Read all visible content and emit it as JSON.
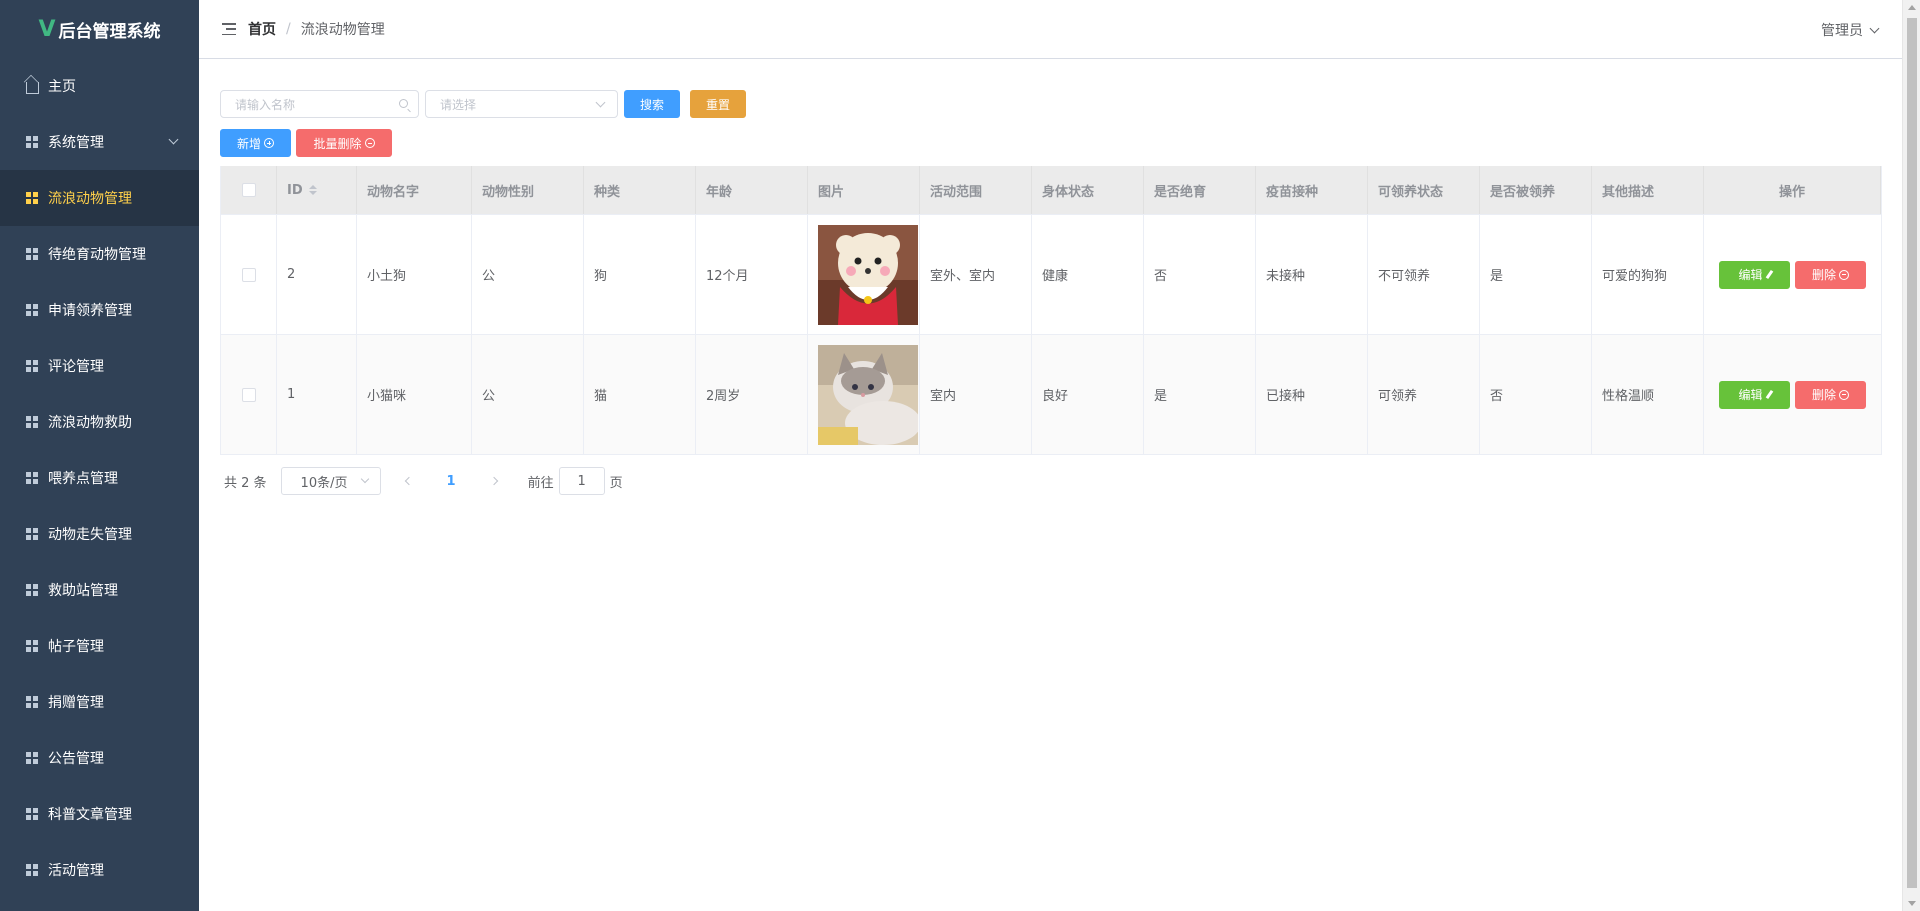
{
  "app": {
    "title": "后台管理系统",
    "logo_letter": "V",
    "accent": "#41b883"
  },
  "sidebar": {
    "bg": "#304156",
    "items": [
      {
        "label": "主页",
        "icon": "home-icon"
      },
      {
        "label": "系统管理",
        "icon": "grid-icon",
        "expandable": true
      },
      {
        "label": "流浪动物管理",
        "icon": "grid-icon",
        "active": true
      },
      {
        "label": "待绝育动物管理",
        "icon": "grid-icon"
      },
      {
        "label": "申请领养管理",
        "icon": "grid-icon"
      },
      {
        "label": "评论管理",
        "icon": "grid-icon"
      },
      {
        "label": "流浪动物救助",
        "icon": "grid-icon"
      },
      {
        "label": "喂养点管理",
        "icon": "grid-icon"
      },
      {
        "label": "动物走失管理",
        "icon": "grid-icon"
      },
      {
        "label": "救助站管理",
        "icon": "grid-icon"
      },
      {
        "label": "帖子管理",
        "icon": "grid-icon"
      },
      {
        "label": "捐赠管理",
        "icon": "grid-icon"
      },
      {
        "label": "公告管理",
        "icon": "grid-icon"
      },
      {
        "label": "科普文章管理",
        "icon": "grid-icon"
      },
      {
        "label": "活动管理",
        "icon": "grid-icon"
      }
    ]
  },
  "header": {
    "breadcrumb": {
      "home": "首页",
      "separator": "/",
      "current": "流浪动物管理"
    },
    "user": "管理员"
  },
  "search": {
    "name_placeholder": "请输入名称",
    "select_placeholder": "请选择",
    "search_label": "搜索",
    "reset_label": "重置"
  },
  "actions": {
    "add_label": "新增",
    "batch_delete_label": "批量删除"
  },
  "table": {
    "columns": [
      "ID",
      "动物名字",
      "动物性别",
      "种类",
      "年龄",
      "图片",
      "活动范围",
      "身体状态",
      "是否绝育",
      "疫苗接种",
      "可领养状态",
      "是否被领养",
      "其他描述",
      "操作"
    ],
    "rows": [
      {
        "id": "2",
        "name": "小土狗",
        "gender": "公",
        "kind": "狗",
        "age": "12个月",
        "image": "dog-photo",
        "range": "室外、室内",
        "health": "健康",
        "neutered": "否",
        "vaccine": "未接种",
        "adoptable": "不可领养",
        "adopted": "是",
        "desc": "可爱的狗狗"
      },
      {
        "id": "1",
        "name": "小猫咪",
        "gender": "公",
        "kind": "猫",
        "age": "2周岁",
        "image": "cat-photo",
        "range": "室内",
        "health": "良好",
        "neutered": "是",
        "vaccine": "已接种",
        "adoptable": "可领养",
        "adopted": "否",
        "desc": "性格温顺"
      }
    ],
    "edit_label": "编辑",
    "delete_label": "删除"
  },
  "pagination": {
    "total_text": "共 2 条",
    "page_size": "10条/页",
    "current_page": "1",
    "goto_label": "前往",
    "goto_value": "1",
    "page_suffix": "页"
  }
}
